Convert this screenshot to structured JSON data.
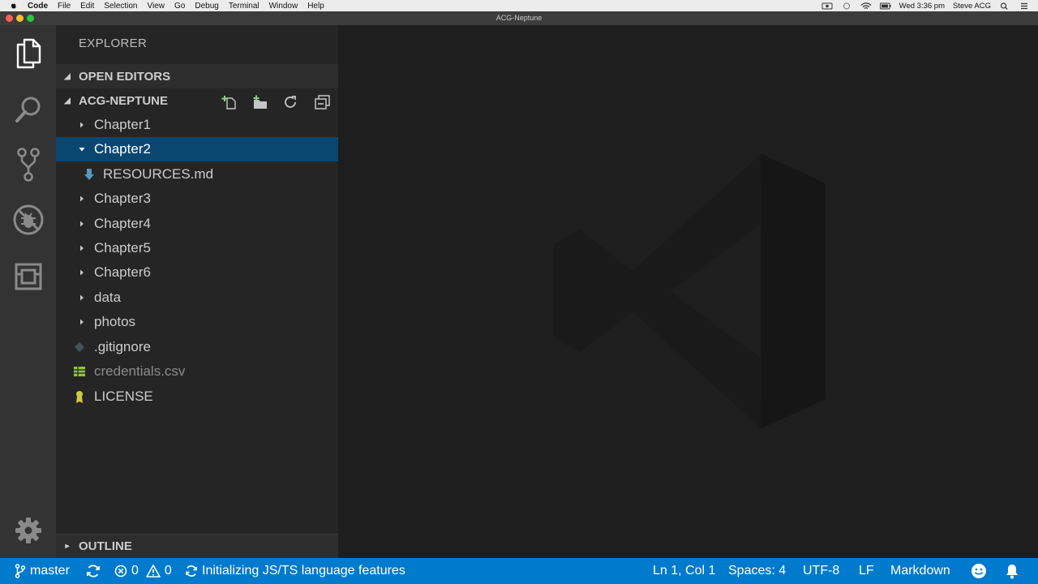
{
  "menubar": {
    "app_name": "Code",
    "items": [
      "File",
      "Edit",
      "Selection",
      "View",
      "Go",
      "Debug",
      "Terminal",
      "Window",
      "Help"
    ],
    "clock": "Wed 3:36 pm",
    "user": "Steve ACG"
  },
  "window": {
    "title": "ACG-Neptune"
  },
  "sidebar": {
    "title": "EXPLORER",
    "open_editors_label": "OPEN EDITORS",
    "project_label": "ACG-NEPTUNE",
    "outline_label": "OUTLINE",
    "tree": [
      {
        "label": "Chapter1",
        "kind": "folder",
        "expanded": false
      },
      {
        "label": "Chapter2",
        "kind": "folder",
        "expanded": true,
        "selected": true
      },
      {
        "label": "RESOURCES.md",
        "kind": "file",
        "icon": "markdown-icon"
      },
      {
        "label": "Chapter3",
        "kind": "folder",
        "expanded": false
      },
      {
        "label": "Chapter4",
        "kind": "folder",
        "expanded": false
      },
      {
        "label": "Chapter5",
        "kind": "folder",
        "expanded": false
      },
      {
        "label": "Chapter6",
        "kind": "folder",
        "expanded": false
      },
      {
        "label": "data",
        "kind": "folder",
        "expanded": false
      },
      {
        "label": "photos",
        "kind": "folder",
        "expanded": false
      },
      {
        "label": ".gitignore",
        "kind": "file",
        "icon": "git-icon"
      },
      {
        "label": "credentials.csv",
        "kind": "file",
        "icon": "csv-icon",
        "dimmed": true
      },
      {
        "label": "LICENSE",
        "kind": "file",
        "icon": "license-icon"
      }
    ]
  },
  "statusbar": {
    "branch": "master",
    "errors": "0",
    "warnings": "0",
    "message": "Initializing JS/TS language features",
    "position": "Ln 1, Col 1",
    "spaces": "Spaces: 4",
    "encoding": "UTF-8",
    "eol": "LF",
    "language": "Markdown"
  },
  "colors": {
    "accent": "#007acc",
    "selection": "#094771",
    "sidebar_bg": "#252526",
    "editor_bg": "#1e1e1e",
    "activity_bg": "#333333"
  }
}
